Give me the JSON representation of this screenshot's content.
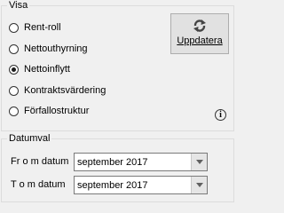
{
  "visa": {
    "title": "Visa",
    "options": [
      {
        "label": "Rent-roll",
        "selected": false
      },
      {
        "label": "Nettouthyrning",
        "selected": false
      },
      {
        "label": "Nettoinflytt",
        "selected": true
      },
      {
        "label": "Kontraktsvärdering",
        "selected": false
      },
      {
        "label": "Förfallostruktur",
        "selected": false
      }
    ],
    "update_button": {
      "label": "Uppdatera",
      "icon": "refresh-icon"
    },
    "info_icon": {
      "glyph": "i",
      "icon": "info-icon"
    }
  },
  "datumval": {
    "title": "Datumval",
    "from": {
      "label": "Fr o m datum",
      "value": "september 2017"
    },
    "to": {
      "label": "T o m datum",
      "value": "september 2017"
    }
  }
}
